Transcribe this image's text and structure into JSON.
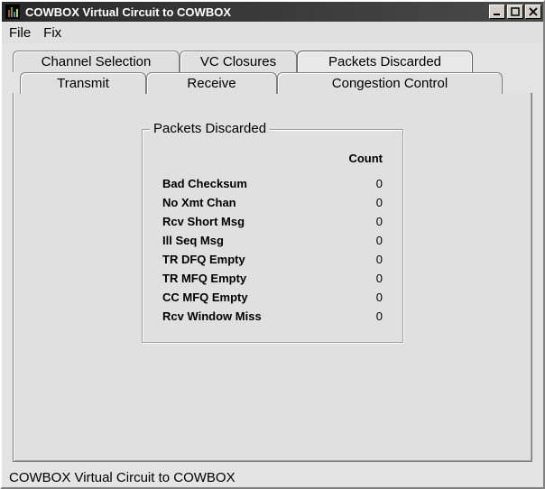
{
  "window": {
    "title": "COWBOX Virtual Circuit to COWBOX"
  },
  "menu": {
    "file": "File",
    "fix": "Fix"
  },
  "tabs": {
    "channel_selection": "Channel Selection",
    "vc_closures": "VC Closures",
    "packets_discarded": "Packets Discarded",
    "transmit": "Transmit",
    "receive": "Receive",
    "congestion_control": "Congestion Control"
  },
  "panel": {
    "legend": "Packets Discarded",
    "count_header": "Count",
    "rows": [
      {
        "label": "Bad Checksum",
        "value": "0"
      },
      {
        "label": "No Xmt Chan",
        "value": "0"
      },
      {
        "label": "Rcv Short Msg",
        "value": "0"
      },
      {
        "label": "Ill Seq Msg",
        "value": "0"
      },
      {
        "label": "TR DFQ Empty",
        "value": "0"
      },
      {
        "label": "TR MFQ Empty",
        "value": "0"
      },
      {
        "label": "CC MFQ Empty",
        "value": "0"
      },
      {
        "label": "Rcv Window Miss",
        "value": "0"
      }
    ]
  },
  "statusbar": {
    "text": "COWBOX Virtual Circuit to COWBOX"
  }
}
